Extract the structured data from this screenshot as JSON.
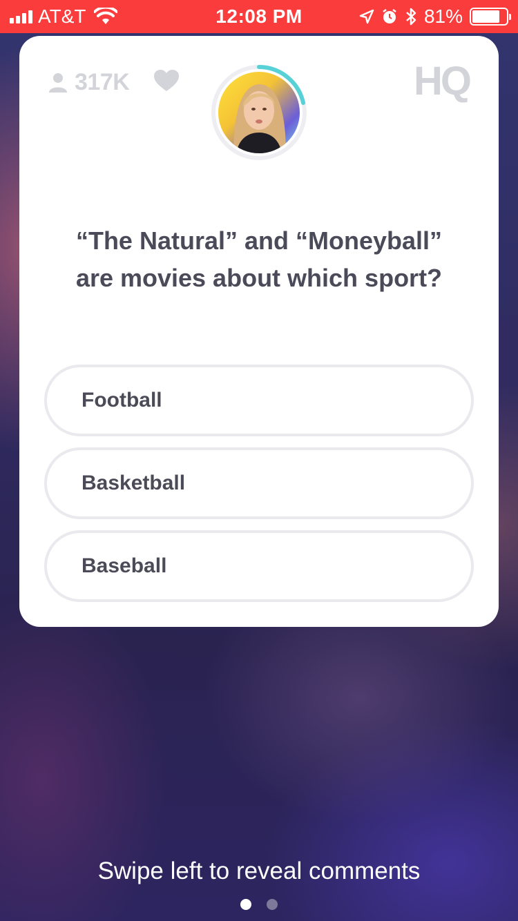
{
  "status_bar": {
    "carrier": "AT&T",
    "time": "12:08 PM",
    "battery_percent": "81%",
    "battery_level": 0.81,
    "color": "#fb3c3c"
  },
  "header": {
    "viewer_count": "317K",
    "logo": "HQ"
  },
  "question": {
    "line1": "“The Natural” and “Moneyball”",
    "line2": "are movies about which sport?"
  },
  "answers": [
    {
      "label": "Football"
    },
    {
      "label": "Basketball"
    },
    {
      "label": "Baseball"
    }
  ],
  "footer": {
    "swipe_hint": "Swipe left to reveal comments",
    "pages": 2,
    "active_page": 1
  },
  "icons": [
    "signal-icon",
    "wifi-icon",
    "location-icon",
    "alarm-icon",
    "bluetooth-icon",
    "battery-icon",
    "user-icon",
    "heart-icon"
  ],
  "colors": {
    "accent_ring": "#57d1d6",
    "muted": "#d3d4d9",
    "text": "#4a4a59"
  }
}
